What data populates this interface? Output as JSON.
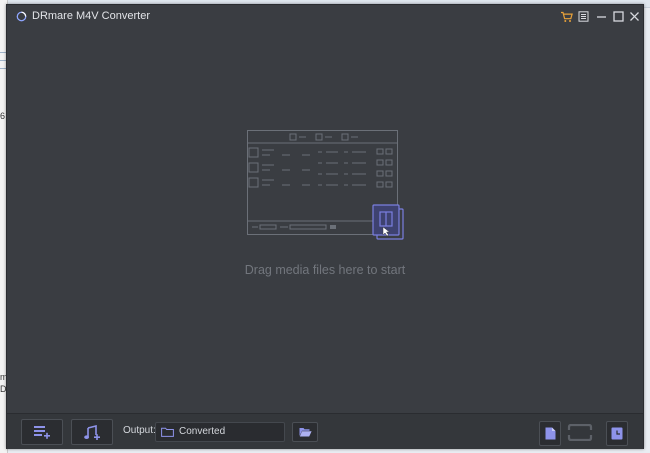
{
  "window": {
    "title": "DRmare M4V Converter"
  },
  "titlebar_controls": [
    {
      "name": "store-icon"
    },
    {
      "name": "menu-icon"
    },
    {
      "name": "minimize-icon"
    },
    {
      "name": "maximize-icon"
    },
    {
      "name": "close-icon"
    }
  ],
  "main": {
    "drop_hint": "Drag media files here to start"
  },
  "bottom": {
    "output_label": "Output:",
    "output_value": "Converted"
  },
  "colors": {
    "window_bg": "#3a3d42",
    "accent": "#7a7fe0",
    "text_muted": "#72767d"
  },
  "background_fragments": [
    "6",
    "m",
    "D"
  ]
}
